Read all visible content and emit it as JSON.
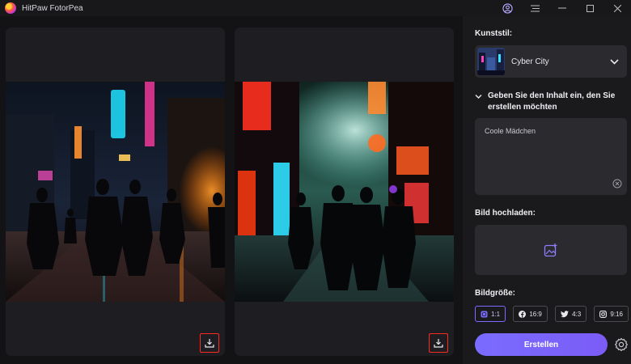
{
  "app": {
    "title": "HitPaw FotorPea"
  },
  "window_controls": {
    "account": "account-icon",
    "menu": "menu-icon",
    "minimize": "—",
    "maximize": "☐",
    "close": "✕"
  },
  "panel": {
    "style_label": "Kunststil:",
    "style_value": "Cyber City",
    "prompt_heading": "Geben Sie den Inhalt ein, den Sie erstellen möchten",
    "prompt_value": "Coole Mädchen",
    "upload_label": "Bild hochladen:",
    "size_label": "Bildgröße:",
    "sizes": [
      {
        "label": "1:1",
        "icon": "square-icon",
        "active": true
      },
      {
        "label": "16:9",
        "icon": "facebook-icon",
        "active": false
      },
      {
        "label": "4:3",
        "icon": "twitter-icon",
        "active": false
      },
      {
        "label": "9:16",
        "icon": "instagram-icon",
        "active": false
      }
    ],
    "create_label": "Erstellen"
  },
  "colors": {
    "accent": "#7b6cff",
    "highlight": "#ff2a1f",
    "panel": "#1a1a1d",
    "field": "#2a2a2f"
  }
}
